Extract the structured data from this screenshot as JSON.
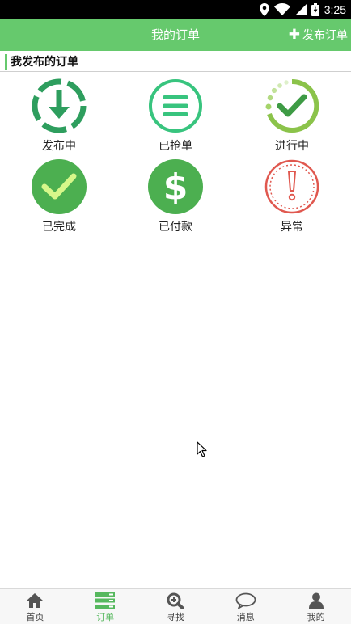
{
  "status_bar": {
    "time": "3:25",
    "icons": [
      "location-icon",
      "wifi-icon",
      "signal-icon",
      "battery-icon"
    ]
  },
  "header": {
    "title": "我的订单",
    "publish_label": "发布订单",
    "background": "#66c96d"
  },
  "section": {
    "title": "我发布的订单"
  },
  "orders": [
    {
      "label": "发布中",
      "icon": "download-arrow-icon",
      "color": "#2e9e5e"
    },
    {
      "label": "已抢单",
      "icon": "menu-lines-icon",
      "color": "#38c47e"
    },
    {
      "label": "进行中",
      "icon": "progress-check-icon",
      "color": "#8bc34a"
    },
    {
      "label": "已完成",
      "icon": "check-circle-icon",
      "color": "#4caf50"
    },
    {
      "label": "已付款",
      "icon": "dollar-icon",
      "color": "#4caf50"
    },
    {
      "label": "异常",
      "icon": "exclamation-icon",
      "color": "#e0584f"
    }
  ],
  "nav": {
    "items": [
      {
        "label": "首页",
        "icon": "home-icon"
      },
      {
        "label": "订单",
        "icon": "order-list-icon",
        "active": true
      },
      {
        "label": "寻找",
        "icon": "search-zoom-icon"
      },
      {
        "label": "消息",
        "icon": "chat-bubble-icon"
      },
      {
        "label": "我的",
        "icon": "user-icon"
      }
    ],
    "active_color": "#56b85e"
  }
}
